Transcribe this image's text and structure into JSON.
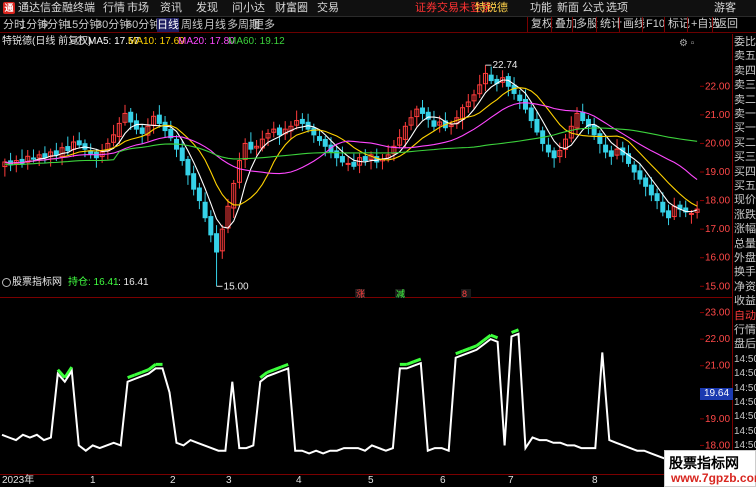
{
  "app": {
    "title": "通达信金融终端",
    "menu": [
      "行情",
      "市场",
      "资讯",
      "发现",
      "问小达",
      "财富圈",
      "交易"
    ],
    "notice": "证券交易未登录",
    "stock_name_short": "特锐德",
    "right_menu": [
      "功能",
      "新面",
      "公式",
      "选项"
    ],
    "user": "游客"
  },
  "periods": {
    "items": [
      "分时",
      "1分钟",
      "5分钟",
      "15分钟",
      "30分钟",
      "60分钟",
      "日线",
      "周线",
      "月线",
      "多周期",
      "更多"
    ],
    "active": "日线"
  },
  "toolbar": {
    "items": [
      "复权",
      "叠加",
      "多股",
      "统计",
      "画线",
      "F10",
      "标记",
      "+自选",
      "返回"
    ]
  },
  "main": {
    "header_title": "特锐德(日线 前复权)",
    "ma": [
      {
        "label": "MA5: 17.57",
        "color": "#ffffff"
      },
      {
        "label": "MA10: 17.69",
        "color": "#ffd200"
      },
      {
        "label": "MA20: 17.80",
        "color": "#ff48ff"
      },
      {
        "label": "MA60: 19.12",
        "color": "#3cd23c"
      }
    ],
    "max_label": "22.74",
    "min_label": "15.00",
    "signals": [
      {
        "text": "涨",
        "color": "#ff4040"
      },
      {
        "text": "减",
        "color": "#40ff40"
      },
      {
        "text": "8",
        "color": "#ff4040"
      }
    ],
    "yticks": [
      "22.00",
      "21.00",
      "20.00",
      "19.00",
      "18.00",
      "17.00",
      "16.00",
      "15.00"
    ],
    "ylim": [
      14.8,
      23.2
    ],
    "colors": {
      "up": "#ff3c3c",
      "down": "#36d2e8"
    }
  },
  "sub": {
    "title": "股票指标网",
    "hold_label": "持仓: 16.41",
    "value_label": ": 16.41",
    "yticks": [
      "23.00",
      "22.00",
      "21.00",
      "20.00",
      "19.00",
      "18.00"
    ],
    "current_value": "19.64",
    "ylim": [
      17.0,
      24.0
    ]
  },
  "xaxis": {
    "labels": [
      "2023年",
      "1",
      "2",
      "3",
      "4",
      "5",
      "6",
      "7",
      "8"
    ]
  },
  "right_panel": {
    "items": [
      "委比",
      "卖五",
      "卖四",
      "卖三",
      "卖二",
      "卖一",
      "买一",
      "买二",
      "买三",
      "买四",
      "买五",
      "现价",
      "涨跌",
      "涨幅",
      "总量",
      "外盘",
      "换手",
      "净资",
      "收益",
      "自动",
      "行情",
      "盘后",
      "14:50",
      "14:50",
      "14:50",
      "14:50",
      "14:50",
      "14:50",
      "14:50",
      "14:50"
    ]
  },
  "watermark": {
    "line1": "股票指标网",
    "line2": "www.7gpzb.com"
  },
  "chart_data": {
    "type": "candlestick",
    "close": [
      19.35,
      19.25,
      19.4,
      19.3,
      19.55,
      19.45,
      19.6,
      19.5,
      19.7,
      19.6,
      19.85,
      19.75,
      20.05,
      19.95,
      19.8,
      19.65,
      19.5,
      19.7,
      20.0,
      20.3,
      20.7,
      21.05,
      20.75,
      20.5,
      20.35,
      20.6,
      20.95,
      20.7,
      20.45,
      20.2,
      19.8,
      19.4,
      18.9,
      18.4,
      18.0,
      17.4,
      16.8,
      16.2,
      17.0,
      17.8,
      18.6,
      19.4,
      20.0,
      19.8,
      19.9,
      20.15,
      20.35,
      20.5,
      20.3,
      20.5,
      20.6,
      20.8,
      20.7,
      20.5,
      20.3,
      20.1,
      19.9,
      19.7,
      19.5,
      19.35,
      19.3,
      19.2,
      19.5,
      19.4,
      19.6,
      19.35,
      19.45,
      19.6,
      19.9,
      20.2,
      20.6,
      20.9,
      21.2,
      21.05,
      20.85,
      20.6,
      20.75,
      20.55,
      20.65,
      20.9,
      21.25,
      21.45,
      21.7,
      22.05,
      22.45,
      22.2,
      22.1,
      22.3,
      22.0,
      21.75,
      21.5,
      21.2,
      20.8,
      20.4,
      20.0,
      19.7,
      19.5,
      19.75,
      20.15,
      20.6,
      21.05,
      20.8,
      20.6,
      20.3,
      20.0,
      19.7,
      19.55,
      19.8,
      19.6,
      19.3,
      19.0,
      18.75,
      18.5,
      18.2,
      18.0,
      17.6,
      17.4,
      17.8,
      17.7,
      17.6,
      17.55,
      17.7
    ],
    "low_min": 15.0,
    "high_max": 22.74,
    "ma_values": {
      "MA5": 17.57,
      "MA10": 17.69,
      "MA20": 17.8,
      "MA60": 19.12
    },
    "indicator_series": {
      "name": "持仓",
      "last": 16.41,
      "segments": [
        {
          "from": 0,
          "to": 7,
          "values": [
            18.4,
            18.3,
            18.2,
            18.4,
            18.3,
            18.4,
            18.2,
            18.3
          ]
        },
        {
          "from": 8,
          "to": 10,
          "values": [
            20.7,
            20.4,
            20.8
          ]
        },
        {
          "from": 11,
          "to": 26,
          "values": [
            18.0,
            17.8,
            18.0,
            17.9,
            18.0,
            18.1,
            18.0,
            20.4,
            20.5,
            20.6,
            20.7,
            20.9,
            20.9,
            20.0,
            18.1,
            18.0
          ]
        },
        {
          "from": 27,
          "to": 41,
          "values": [
            18.2,
            18.1,
            18.0,
            17.9,
            17.8,
            17.8,
            20.4,
            17.9,
            17.9,
            18.0,
            20.4,
            20.6,
            20.7,
            20.8,
            20.9
          ]
        },
        {
          "from": 42,
          "to": 56,
          "values": [
            17.8,
            17.8,
            17.7,
            17.8,
            17.7,
            17.8,
            17.8,
            17.9,
            17.9,
            17.9,
            17.8,
            18.0,
            17.9,
            17.8,
            17.9
          ]
        },
        {
          "from": 57,
          "to": 70,
          "values": [
            20.9,
            20.9,
            21.0,
            21.1,
            17.8,
            17.9,
            17.9,
            17.8,
            21.3,
            21.4,
            21.5,
            21.6,
            21.8,
            22.0
          ]
        },
        {
          "from": 71,
          "to": 79,
          "values": [
            21.9,
            18.0,
            22.1,
            22.2,
            17.9,
            18.3,
            18.2,
            18.2,
            18.1
          ]
        },
        {
          "from": 80,
          "to": 100,
          "values": [
            18.1,
            18.0,
            18.0,
            17.9,
            17.9,
            17.9,
            21.5,
            18.2,
            18.1,
            18.0,
            17.9,
            17.8,
            17.8,
            17.7,
            17.6,
            17.5,
            17.4,
            17.3,
            17.2,
            17.1,
            16.7
          ]
        }
      ]
    }
  }
}
